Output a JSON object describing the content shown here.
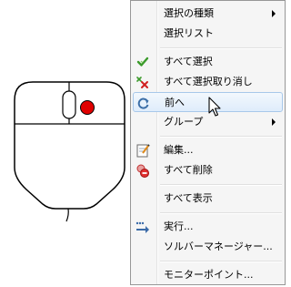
{
  "menu": {
    "items": [
      {
        "label": "選択の種類",
        "submenu": true
      },
      {
        "label": "選択リスト"
      },
      {
        "label": "すべて選択",
        "icon": "green-checkmark-icon"
      },
      {
        "label": "すべて選択取り消し",
        "icon": "red-x-icon"
      },
      {
        "label": "前へ",
        "icon": "circular-arrow-icon",
        "highlighted": true
      },
      {
        "label": "グループ",
        "submenu": true
      },
      {
        "label": "編集...",
        "icon": "edit-document-icon"
      },
      {
        "label": "すべて削除",
        "icon": "delete-icon"
      },
      {
        "label": "すべて表示"
      },
      {
        "label": "実行...",
        "icon": "run-arrow-icon"
      },
      {
        "label": "ソルバーマネージャー..."
      },
      {
        "label": "モニターポイント..."
      }
    ]
  },
  "colors": {
    "menu_background": "#f5f5f5",
    "highlight_border": "#a8c8ea",
    "mouse_button_dot": "#e00000"
  }
}
